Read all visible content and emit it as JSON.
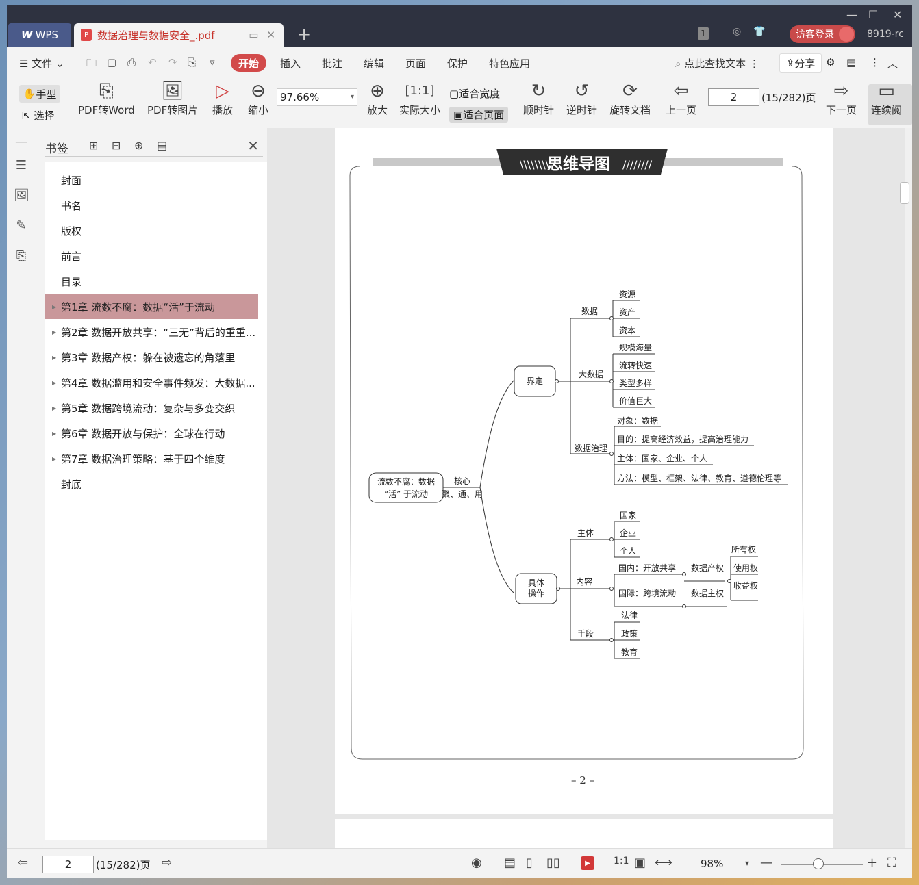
{
  "titlebar": {
    "app_tab": "WPS",
    "doc_tab": "数据治理与数据安全_.pdf",
    "login": "访客登录",
    "user_id": "8919-rc",
    "badge": "1"
  },
  "menu": {
    "file": "文件",
    "items": [
      "开始",
      "插入",
      "批注",
      "编辑",
      "页面",
      "保护",
      "特色应用"
    ],
    "search": "点此查找文本",
    "share": "分享"
  },
  "toolbar": {
    "hand": "手型",
    "select": "选择",
    "pdf_to_word": "PDF转Word",
    "pdf_to_image": "PDF转图片",
    "play": "播放",
    "zoom_out": "缩小",
    "zoom_value": "97.66%",
    "zoom_in": "放大",
    "actual_size": "实际大小",
    "fit_width": "适合宽度",
    "fit_page": "适合页面",
    "clockwise": "顺时针",
    "counterclockwise": "逆时针",
    "rotate_doc": "旋转文档",
    "prev_page": "上一页",
    "page_value": "2",
    "page_total": "(15/282)页",
    "next_page": "下一页",
    "continuous": "连续阅"
  },
  "bookmarks": {
    "title": "书签",
    "items": [
      {
        "label": "封面",
        "expandable": false,
        "active": false
      },
      {
        "label": "书名",
        "expandable": false,
        "active": false
      },
      {
        "label": "版权",
        "expandable": false,
        "active": false
      },
      {
        "label": "前言",
        "expandable": false,
        "active": false
      },
      {
        "label": "目录",
        "expandable": false,
        "active": false
      },
      {
        "label": "第1章 流数不腐：数据“活”于流动",
        "expandable": true,
        "active": true
      },
      {
        "label": "第2章 数据开放共享：“三无”背后的重重...",
        "expandable": true,
        "active": false
      },
      {
        "label": "第3章 数据产权：躲在被遗忘的角落里",
        "expandable": true,
        "active": false
      },
      {
        "label": "第4章 数据滥用和安全事件频发：大数据...",
        "expandable": true,
        "active": false
      },
      {
        "label": "第5章 数据跨境流动：复杂与多变交织",
        "expandable": true,
        "active": false
      },
      {
        "label": "第6章 数据开放与保护：全球在行动",
        "expandable": true,
        "active": false
      },
      {
        "label": "第7章 数据治理策略：基于四个维度",
        "expandable": true,
        "active": false
      },
      {
        "label": "封底",
        "expandable": false,
        "active": false
      }
    ]
  },
  "page_content": {
    "banner": "思维导图",
    "root_line1": "流数不腐：数据",
    "root_line2": "“活” 于流动",
    "core_label": "核心",
    "core_sub": "聚、通、用",
    "define": "界定",
    "data": "数据",
    "data_children": [
      "资源",
      "资产",
      "资本"
    ],
    "bigdata": "大数据",
    "bigdata_children": [
      "规模海量",
      "流转快速",
      "类型多样",
      "价值巨大"
    ],
    "governance": "数据治理",
    "governance_children": [
      "对象：数据",
      "目的：提高经济效益，提高治理能力",
      "主体：国家、企业、个人",
      "方法：模型、框架、法律、教育、道德伦理等"
    ],
    "operation_line1": "具体",
    "operation_line2": "操作",
    "subject": "主体",
    "subject_children": [
      "国家",
      "企业",
      "个人"
    ],
    "content": "内容",
    "domestic": "国内：开放共享",
    "international": "国际：跨境流动",
    "data_property": "数据产权",
    "data_sovereignty": "数据主权",
    "rights": [
      "所有权",
      "使用权",
      "收益权"
    ],
    "means": "手段",
    "means_children": [
      "法律",
      "政策",
      "教育"
    ],
    "page_number": "– 2 –"
  },
  "statusbar": {
    "page_value": "2",
    "page_total": "(15/282)页",
    "zoom": "98%"
  }
}
